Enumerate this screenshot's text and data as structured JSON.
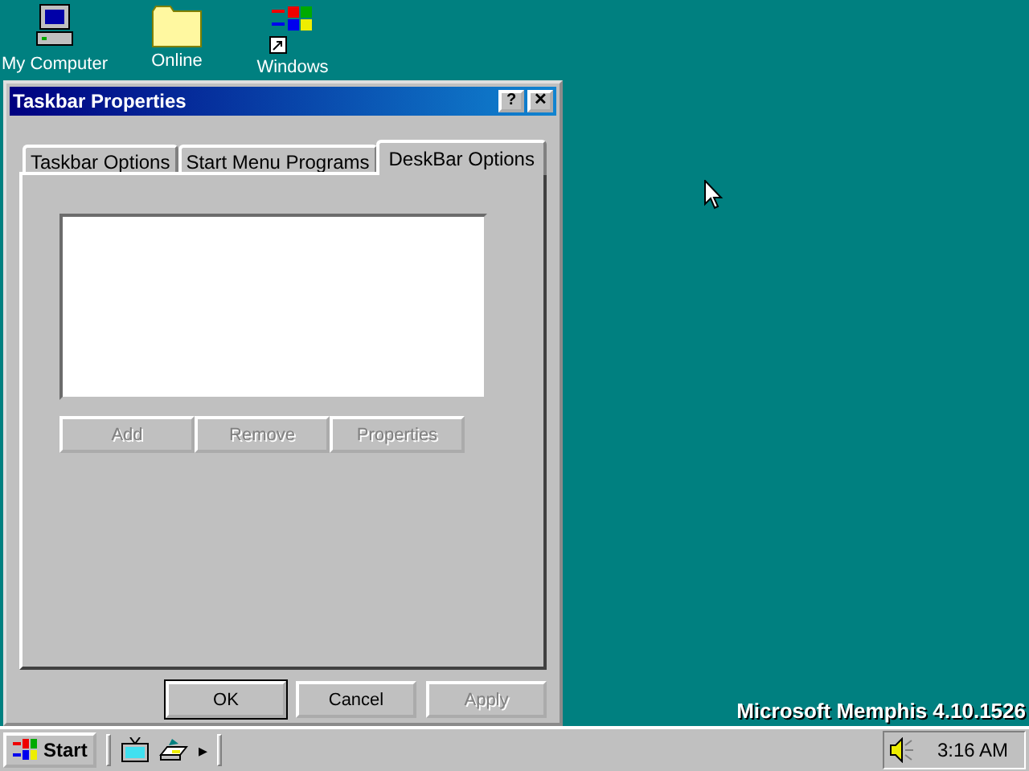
{
  "desktop_icons": [
    {
      "kind": "computer",
      "label": "My Computer"
    },
    {
      "kind": "folder",
      "label": "Online"
    },
    {
      "kind": "windows",
      "label": "Windows"
    }
  ],
  "window": {
    "title": "Taskbar Properties",
    "help_button": "?",
    "close_button": "✕"
  },
  "tabs": [
    {
      "label": "Taskbar Options",
      "selected": false
    },
    {
      "label": "Start Menu Programs",
      "selected": false
    },
    {
      "label": "DeskBar Options",
      "selected": true
    }
  ],
  "panel_buttons": [
    {
      "label": "Add",
      "disabled": true
    },
    {
      "label": "Remove",
      "disabled": true
    },
    {
      "label": "Properties",
      "disabled": true
    }
  ],
  "dialog_buttons": [
    {
      "label": "OK",
      "disabled": false,
      "default": true
    },
    {
      "label": "Cancel",
      "disabled": false,
      "default": false
    },
    {
      "label": "Apply",
      "disabled": true,
      "default": false
    }
  ],
  "desktop_text": "Microsoft Memphis 4.10.1526",
  "taskbar": {
    "start_label": "Start",
    "quick_launch": [
      {
        "kind": "tv"
      },
      {
        "kind": "desk"
      }
    ],
    "more_arrow": "▸",
    "clock": "3:16 AM"
  }
}
